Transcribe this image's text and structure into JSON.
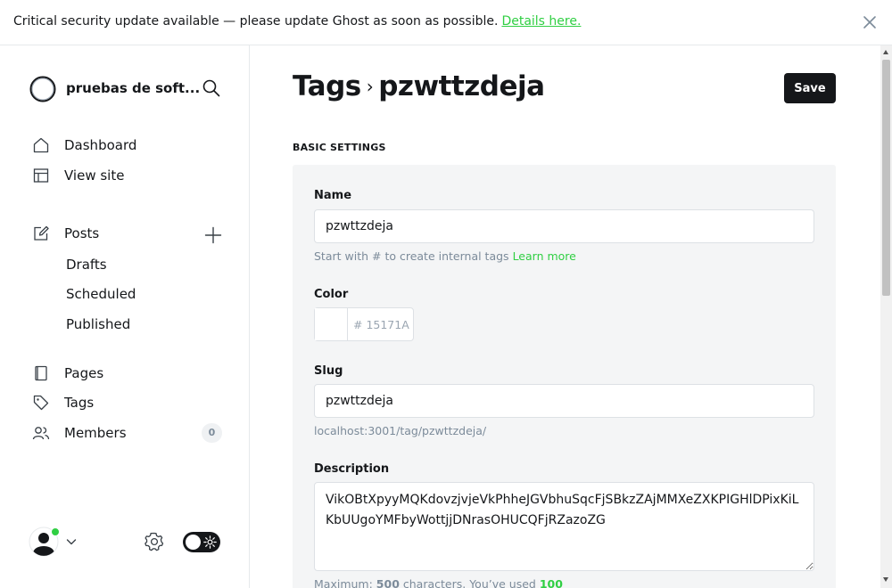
{
  "banner": {
    "message": "Critical security update available — please update Ghost as soon as possible.",
    "link_label": "Details here."
  },
  "sidebar": {
    "site_name": "pruebas de soft...",
    "nav": {
      "dashboard": "Dashboard",
      "view_site": "View site",
      "posts": "Posts",
      "drafts": "Drafts",
      "scheduled": "Scheduled",
      "published": "Published",
      "pages": "Pages",
      "tags": "Tags",
      "members": "Members"
    },
    "members_count": "0"
  },
  "header": {
    "breadcrumb_parent": "Tags",
    "breadcrumb_current": "pzwttzdeja",
    "save_label": "Save"
  },
  "form": {
    "section_title": "BASIC SETTINGS",
    "name": {
      "label": "Name",
      "value": "pzwttzdeja",
      "hint": "Start with # to create internal tags",
      "hint_link": "Learn more"
    },
    "color": {
      "label": "Color",
      "value": "# 15171A"
    },
    "slug": {
      "label": "Slug",
      "value": "pzwttzdeja",
      "url_preview": "localhost:3001/tag/pzwttzdeja/"
    },
    "description": {
      "label": "Description",
      "value": "VikOBtXpyyMQKdovzjvjeVkPhheJGVbhuSqcFjSBkzZAjMMXeZXKPIGHlDPixKiLKbUUgoYMFbyWottjjDNrasOHUCQFjRZazoZG",
      "hint_prefix": "Maximum:",
      "max": "500",
      "hint_mid": "characters. You’ve used",
      "used": "100"
    }
  },
  "colors": {
    "accent": "#30cf43",
    "text": "#15171a",
    "muted": "#7c8b9a",
    "panel": "#f4f5f6",
    "border": "#dde1e5"
  },
  "icons": [
    "close-icon",
    "ghost-logo-icon",
    "search-icon",
    "home-icon",
    "layout-icon",
    "edit-icon",
    "plus-icon",
    "page-icon",
    "tag-icon",
    "members-icon",
    "user-avatar-icon",
    "chevron-down-icon",
    "gear-icon",
    "sun-icon"
  ]
}
